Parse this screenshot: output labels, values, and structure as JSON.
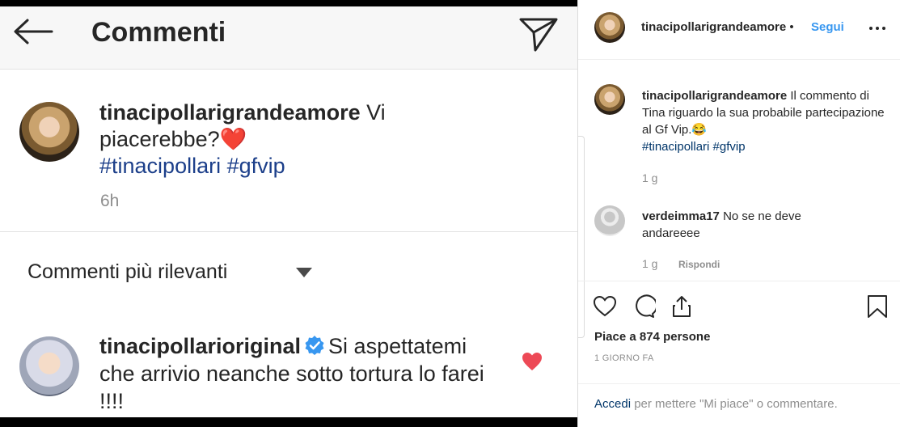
{
  "phone": {
    "title": "Commenti",
    "post": {
      "username": "tinacipollarigrandeamore",
      "text": " Vi piacerebbe?",
      "emoji": "❤️",
      "hashtags": "#tinacipollari #gfvip",
      "time": "6h"
    },
    "sort_label": "Commenti più rilevanti",
    "reply": {
      "username": "tinacipollarioriginal",
      "text": "Si aspettatemi che arrivio neanche sotto tortura lo farei !!!!"
    }
  },
  "panel": {
    "header": {
      "username": "tinacipollarigrandeamore",
      "dot": " • ",
      "follow": "Segui"
    },
    "caption": {
      "username": "tinacipollarigrandeamore",
      "text": " Il commento di Tina riguardo la sua probabile partecipazione al Gf Vip.😂",
      "hashtags": "#tinacipollari #gfvip",
      "time": "1 g"
    },
    "comment": {
      "username": "verdeimma17",
      "text": " No se ne deve andareeee",
      "time": "1 g",
      "reply_label": "Rispondi"
    },
    "likes": "Piace a 874 persone",
    "date": "1 GIORNO FA",
    "login": {
      "link": "Accedi",
      "rest": " per mettere \"Mi piace\" o commentare."
    }
  },
  "colors": {
    "link_blue": "#3897f0",
    "hashtag_dark": "#003569",
    "heart_red": "#ed4956",
    "muted": "#8e8e8e"
  }
}
